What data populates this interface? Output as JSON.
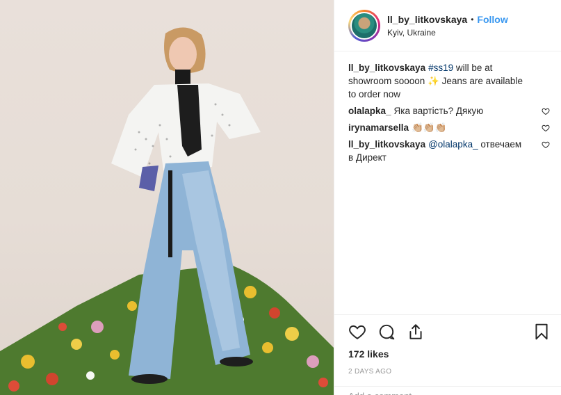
{
  "post": {
    "username": "ll_by_litkovskaya",
    "separator": "•",
    "follow_label": "Follow",
    "location": "Kyiv, Ukraine",
    "likes": "172 likes",
    "timestamp": "2 DAYS AGO",
    "add_comment_placeholder": "Add a comment..."
  },
  "comments": [
    {
      "user": "ll_by_litkovskaya",
      "pre": "",
      "tag": "#ss19",
      "post": " will be at showroom soooon ✨ Jeans are available to order now",
      "has_like": false
    },
    {
      "user": "olalapka_",
      "pre": "Яка вартість? Дякую",
      "tag": "",
      "post": "",
      "has_like": true
    },
    {
      "user": "irynamarsella",
      "pre": "👏🏼👏🏼👏🏼",
      "tag": "",
      "post": "",
      "has_like": true
    },
    {
      "user": "ll_by_litkovskaya",
      "pre": "",
      "tag": "@olalapka_",
      "post": " отвечаем в Директ",
      "has_like": true
    }
  ],
  "icons": {
    "like": "heart-icon",
    "comment": "comment-icon",
    "share": "share-icon",
    "save": "bookmark-icon"
  },
  "colors": {
    "link": "#3897f0",
    "hashtag": "#003569",
    "muted": "#999999",
    "border": "#efefef"
  }
}
